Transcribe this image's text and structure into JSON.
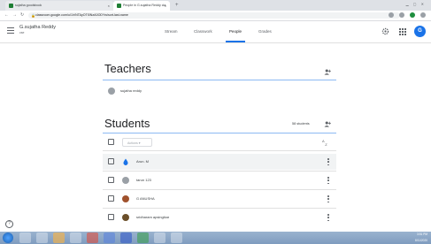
{
  "browser": {
    "tabs": [
      {
        "title": "sujatha goodsbook",
        "active": false
      },
      {
        "title": "People in G.sujatha Reddy cla",
        "active": true
      }
    ],
    "url": "classroom.google.com/u/1/r/NTAyOTI0NzA0ODYw/sort-last-name"
  },
  "header": {
    "class_name": "G.sujatha Reddy",
    "class_section": "cse",
    "tabs": [
      "Stream",
      "Classwork",
      "People",
      "Grades"
    ],
    "active_tab": "People",
    "avatar_letter": "G",
    "accent": "#1a73e8"
  },
  "teachers": {
    "title": "Teachers",
    "list": [
      {
        "name": "sujatha reddy",
        "avatar_color": "#9aa0a6"
      }
    ]
  },
  "students": {
    "title": "Students",
    "count_label": "58 students",
    "actions_label": "Actions ▾",
    "list": [
      {
        "name": "Arun. M",
        "avatar_color": "#1a73e8"
      },
      {
        "name": "tarun 123",
        "avatar_color": "#9aa0a6"
      },
      {
        "name": "G ANUSHA",
        "avatar_color": "#a0522d"
      },
      {
        "name": "sridharam apsingikar",
        "avatar_color": "#6b4f2a"
      }
    ]
  },
  "help_label": "?",
  "taskbar": {
    "time": "3:51 PM",
    "date": "8/11/2020"
  }
}
